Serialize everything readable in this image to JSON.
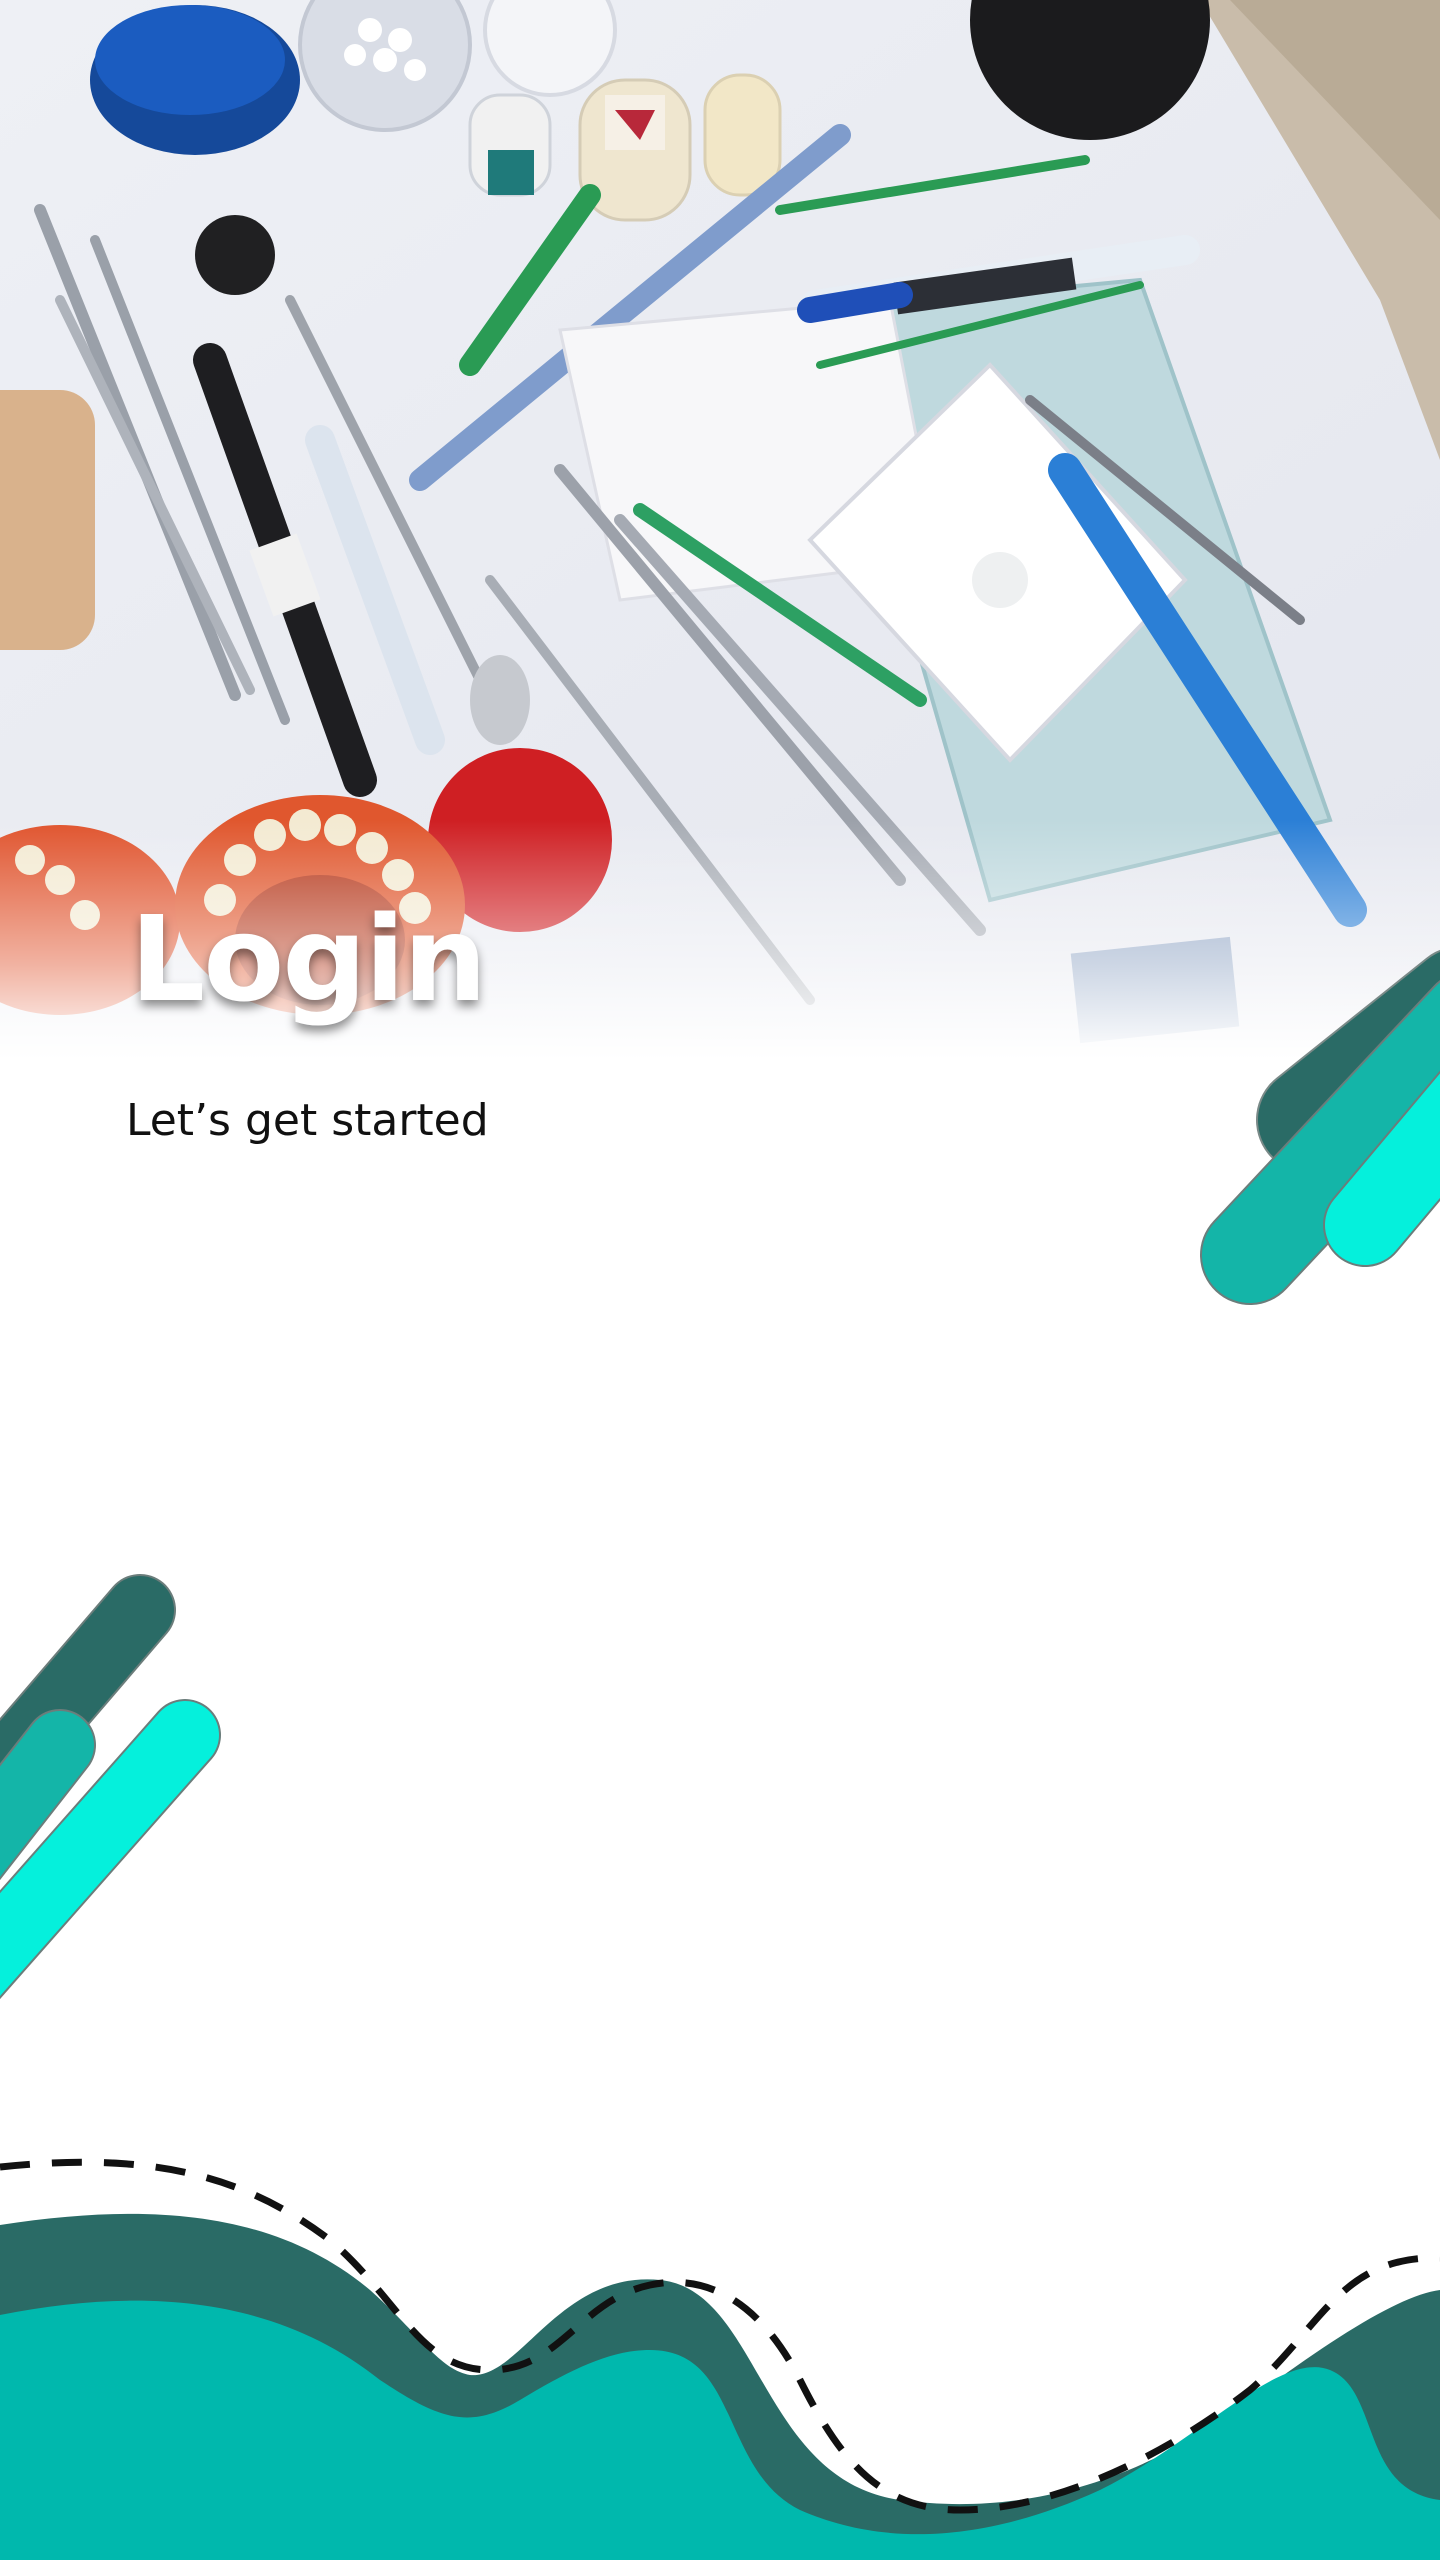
{
  "header": {
    "title": "Login",
    "subtitle": "Let’s get started"
  },
  "hero_image": {
    "subject": "dental instruments on white cloth"
  },
  "colors": {
    "teal_dark": "#2a6b66",
    "teal_mid": "#14b5a8",
    "teal_bright": "#05f0dc",
    "wave_front": "#00b8ad",
    "dash_line": "#111111",
    "background": "#ffffff"
  }
}
